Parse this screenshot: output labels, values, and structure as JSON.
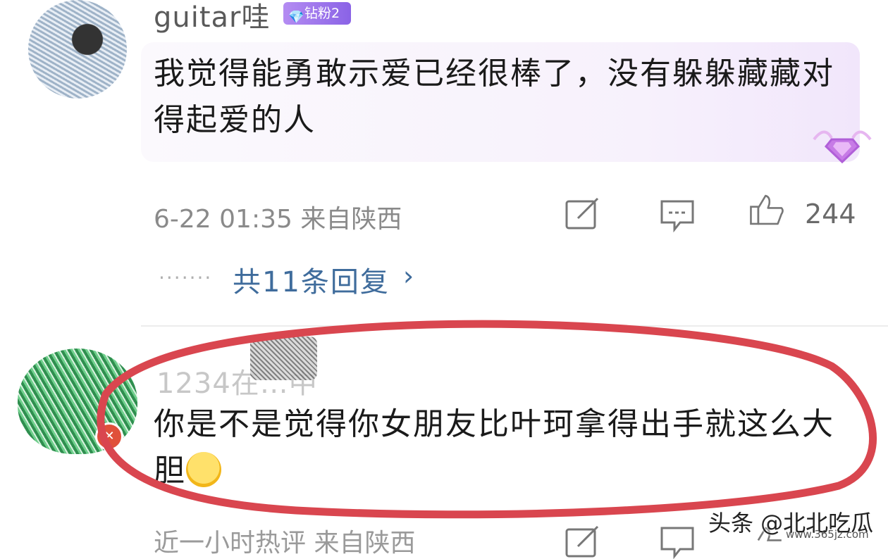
{
  "comment1": {
    "username": "guitar哇",
    "badge": "钻粉2",
    "text": "我觉得能勇敢示爱已经很棒了，没有躲躲藏藏对得起爱的人",
    "meta": "6-22 01:35  来自陕西",
    "like_count": "244",
    "more_dots": "·······",
    "replies_link": "共11条回复",
    "replies_chevron": "›"
  },
  "comment2": {
    "username": "1234在…中",
    "text": "你是不是觉得你女朋友比叶珂拿得出手就这么大胆",
    "meta": "近一小时热评  来自陕西"
  },
  "watermark": {
    "text": "头条 @北北吃瓜",
    "url": "www.365jz.com"
  },
  "colors": {
    "badge": "#8a63e6",
    "link": "#3f6c9c",
    "highlight_ellipse": "#d9464f"
  },
  "icons": [
    "edit-icon",
    "comment-icon",
    "thumbs-up-icon",
    "diamond-icon",
    "laughing-emoji"
  ]
}
